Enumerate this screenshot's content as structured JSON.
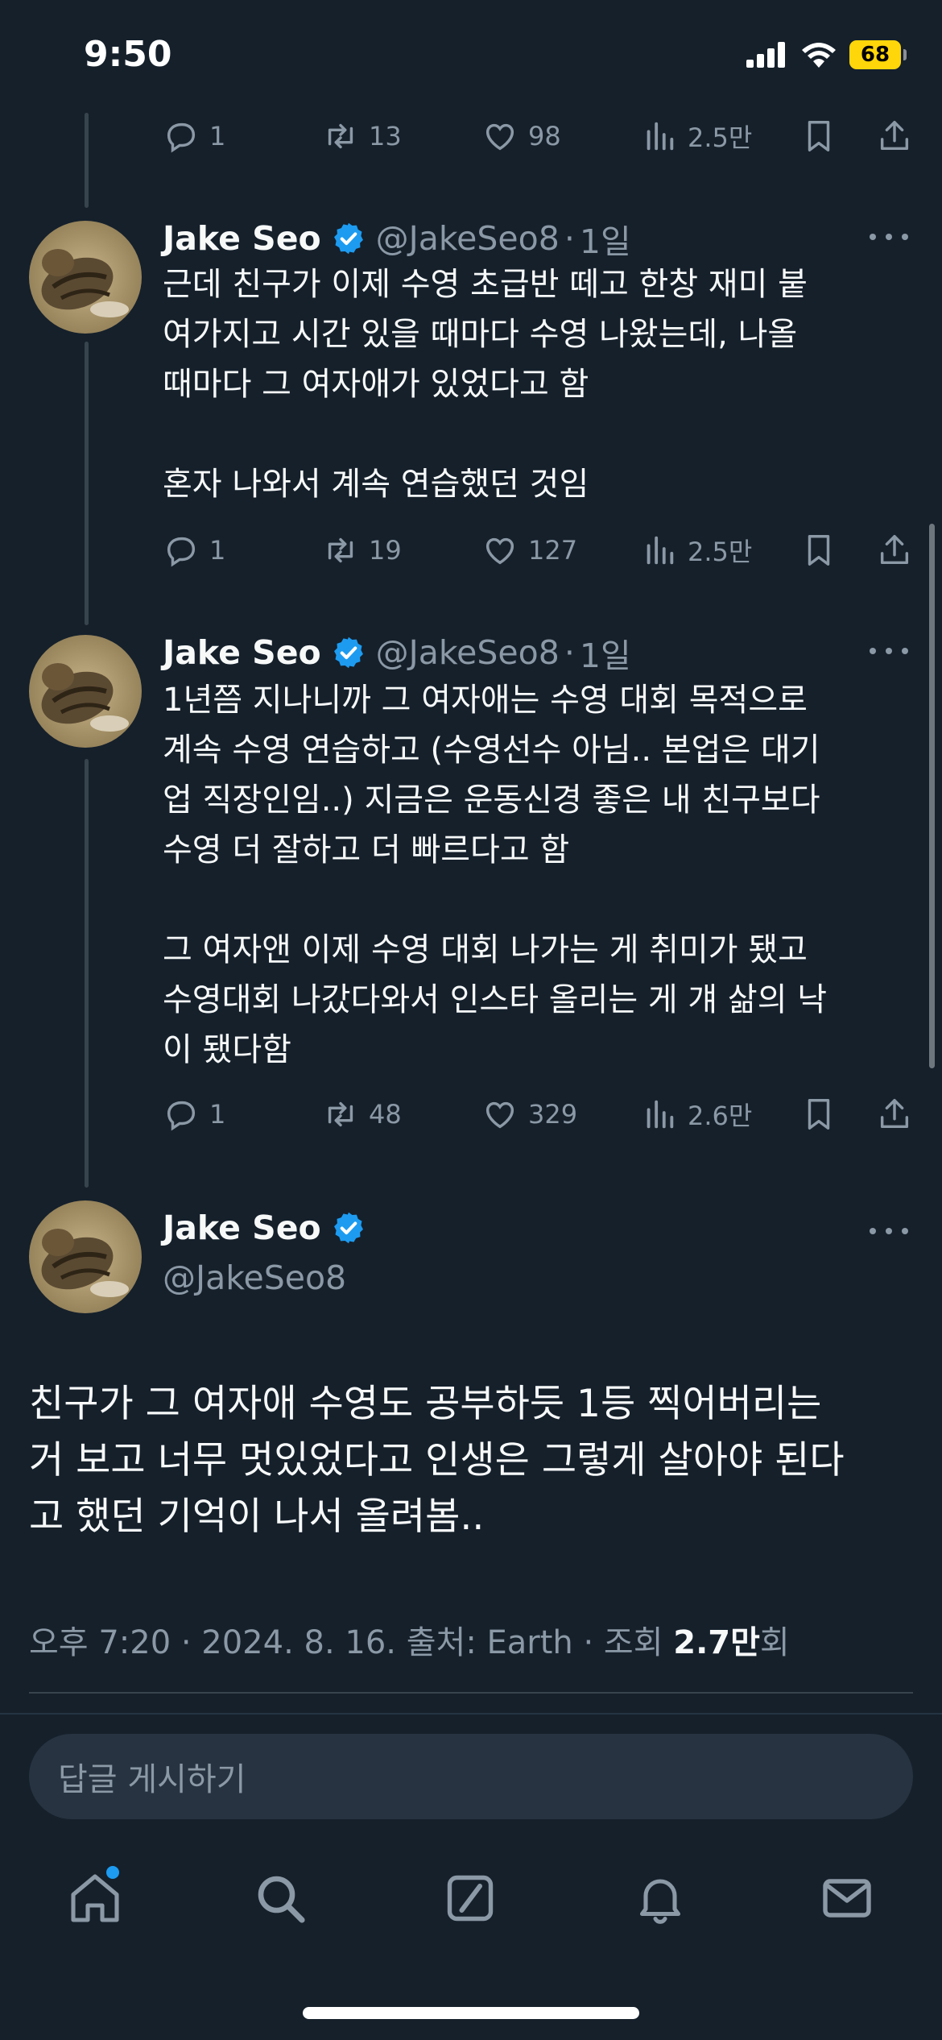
{
  "status_bar": {
    "time": "9:50",
    "battery": "68"
  },
  "tweets": [
    {
      "actions": {
        "replies": "1",
        "retweets": "13",
        "likes": "98",
        "views": "2.5만"
      }
    },
    {
      "name": "Jake Seo",
      "handle": "@JakeSeo8",
      "sep": "·",
      "age": "1일",
      "text": "근데 친구가 이제 수영 초급반 떼고 한창 재미 붙\n여가지고 시간 있을 때마다 수영 나왔는데, 나올\n때마다 그 여자애가 있었다고 함\n\n혼자 나와서 계속 연습했던 것임",
      "actions": {
        "replies": "1",
        "retweets": "19",
        "likes": "127",
        "views": "2.5만"
      }
    },
    {
      "name": "Jake Seo",
      "handle": "@JakeSeo8",
      "sep": "·",
      "age": "1일",
      "text": "1년쯤 지나니까 그 여자애는 수영 대회 목적으로\n계속 수영 연습하고 (수영선수 아님.. 본업은 대기\n업 직장인임..) 지금은 운동신경 좋은 내 친구보다\n수영 더 잘하고 더 빠르다고 함\n\n그 여자앤 이제 수영 대회 나가는 게 취미가 됐고\n수영대회 나갔다와서 인스타 올리는 게 걔 삶의 낙\n이 됐다함",
      "actions": {
        "replies": "1",
        "retweets": "48",
        "likes": "329",
        "views": "2.6만"
      }
    }
  ],
  "focus_tweet": {
    "name": "Jake Seo",
    "handle": "@JakeSeo8",
    "text": "친구가 그 여자애 수영도 공부하듯 1등 찍어버리는\n거 보고 너무 멋있었다고 인생은 그렇게 살아야 된다\n고 했던 기억이 나서 올려봄..",
    "meta_prefix": "오후 7:20 · 2024. 8. 16. 출처: Earth · 조회 ",
    "meta_views": "2.7만",
    "meta_suffix": "회"
  },
  "reply": {
    "placeholder": "답글 게시하기"
  },
  "nav": [
    "home-icon",
    "search-icon",
    "grok-icon",
    "notifications-icon",
    "messages-icon"
  ],
  "colors": {
    "background": "#15202b",
    "accent": "#1d9bf0",
    "muted": "#8b98a5"
  }
}
